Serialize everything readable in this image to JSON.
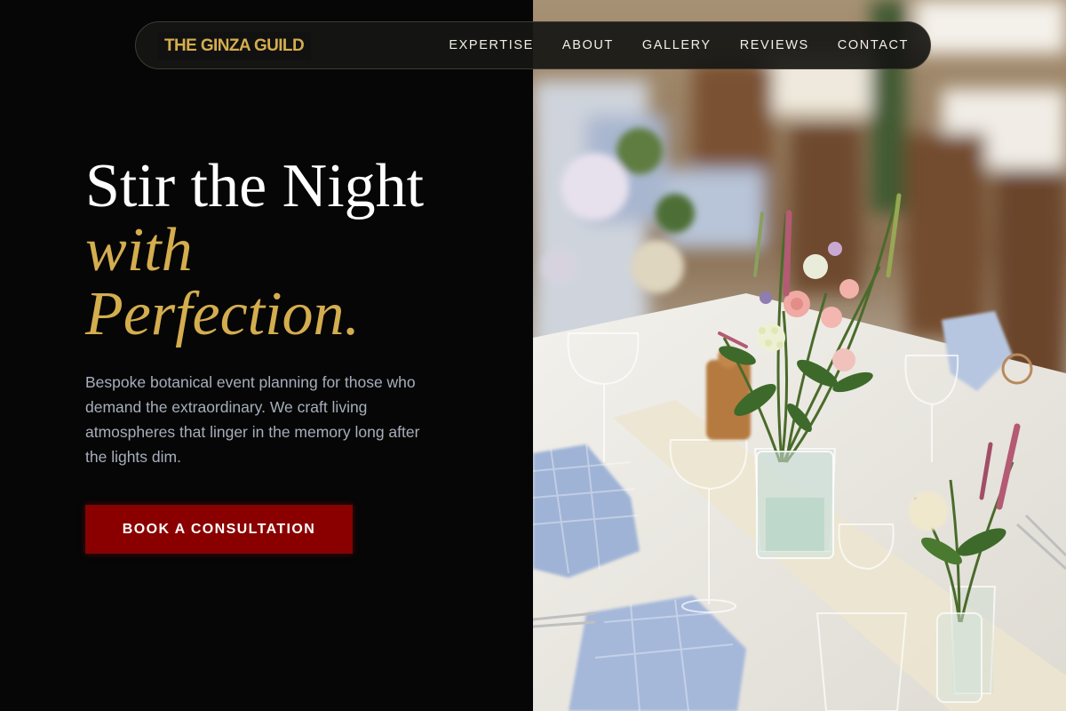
{
  "brand": {
    "logo_text": "THE GINZA GUILD",
    "accent_color": "#d4ad4e"
  },
  "nav": {
    "items": [
      {
        "label": "EXPERTISE"
      },
      {
        "label": "ABOUT"
      },
      {
        "label": "GALLERY"
      },
      {
        "label": "REVIEWS"
      },
      {
        "label": "CONTACT"
      }
    ]
  },
  "hero": {
    "title_line1": "Stir the Night",
    "title_line2": "with",
    "title_line3": "Perfection.",
    "description": "Bespoke botanical event planning for those who demand the extraordinary. We craft living atmospheres that linger in the memory long after the lights dim.",
    "cta_label": "BOOK A CONSULTATION",
    "cta_color": "#8a0000"
  },
  "hero_image": {
    "subject": "floral-table-setting-photo"
  }
}
